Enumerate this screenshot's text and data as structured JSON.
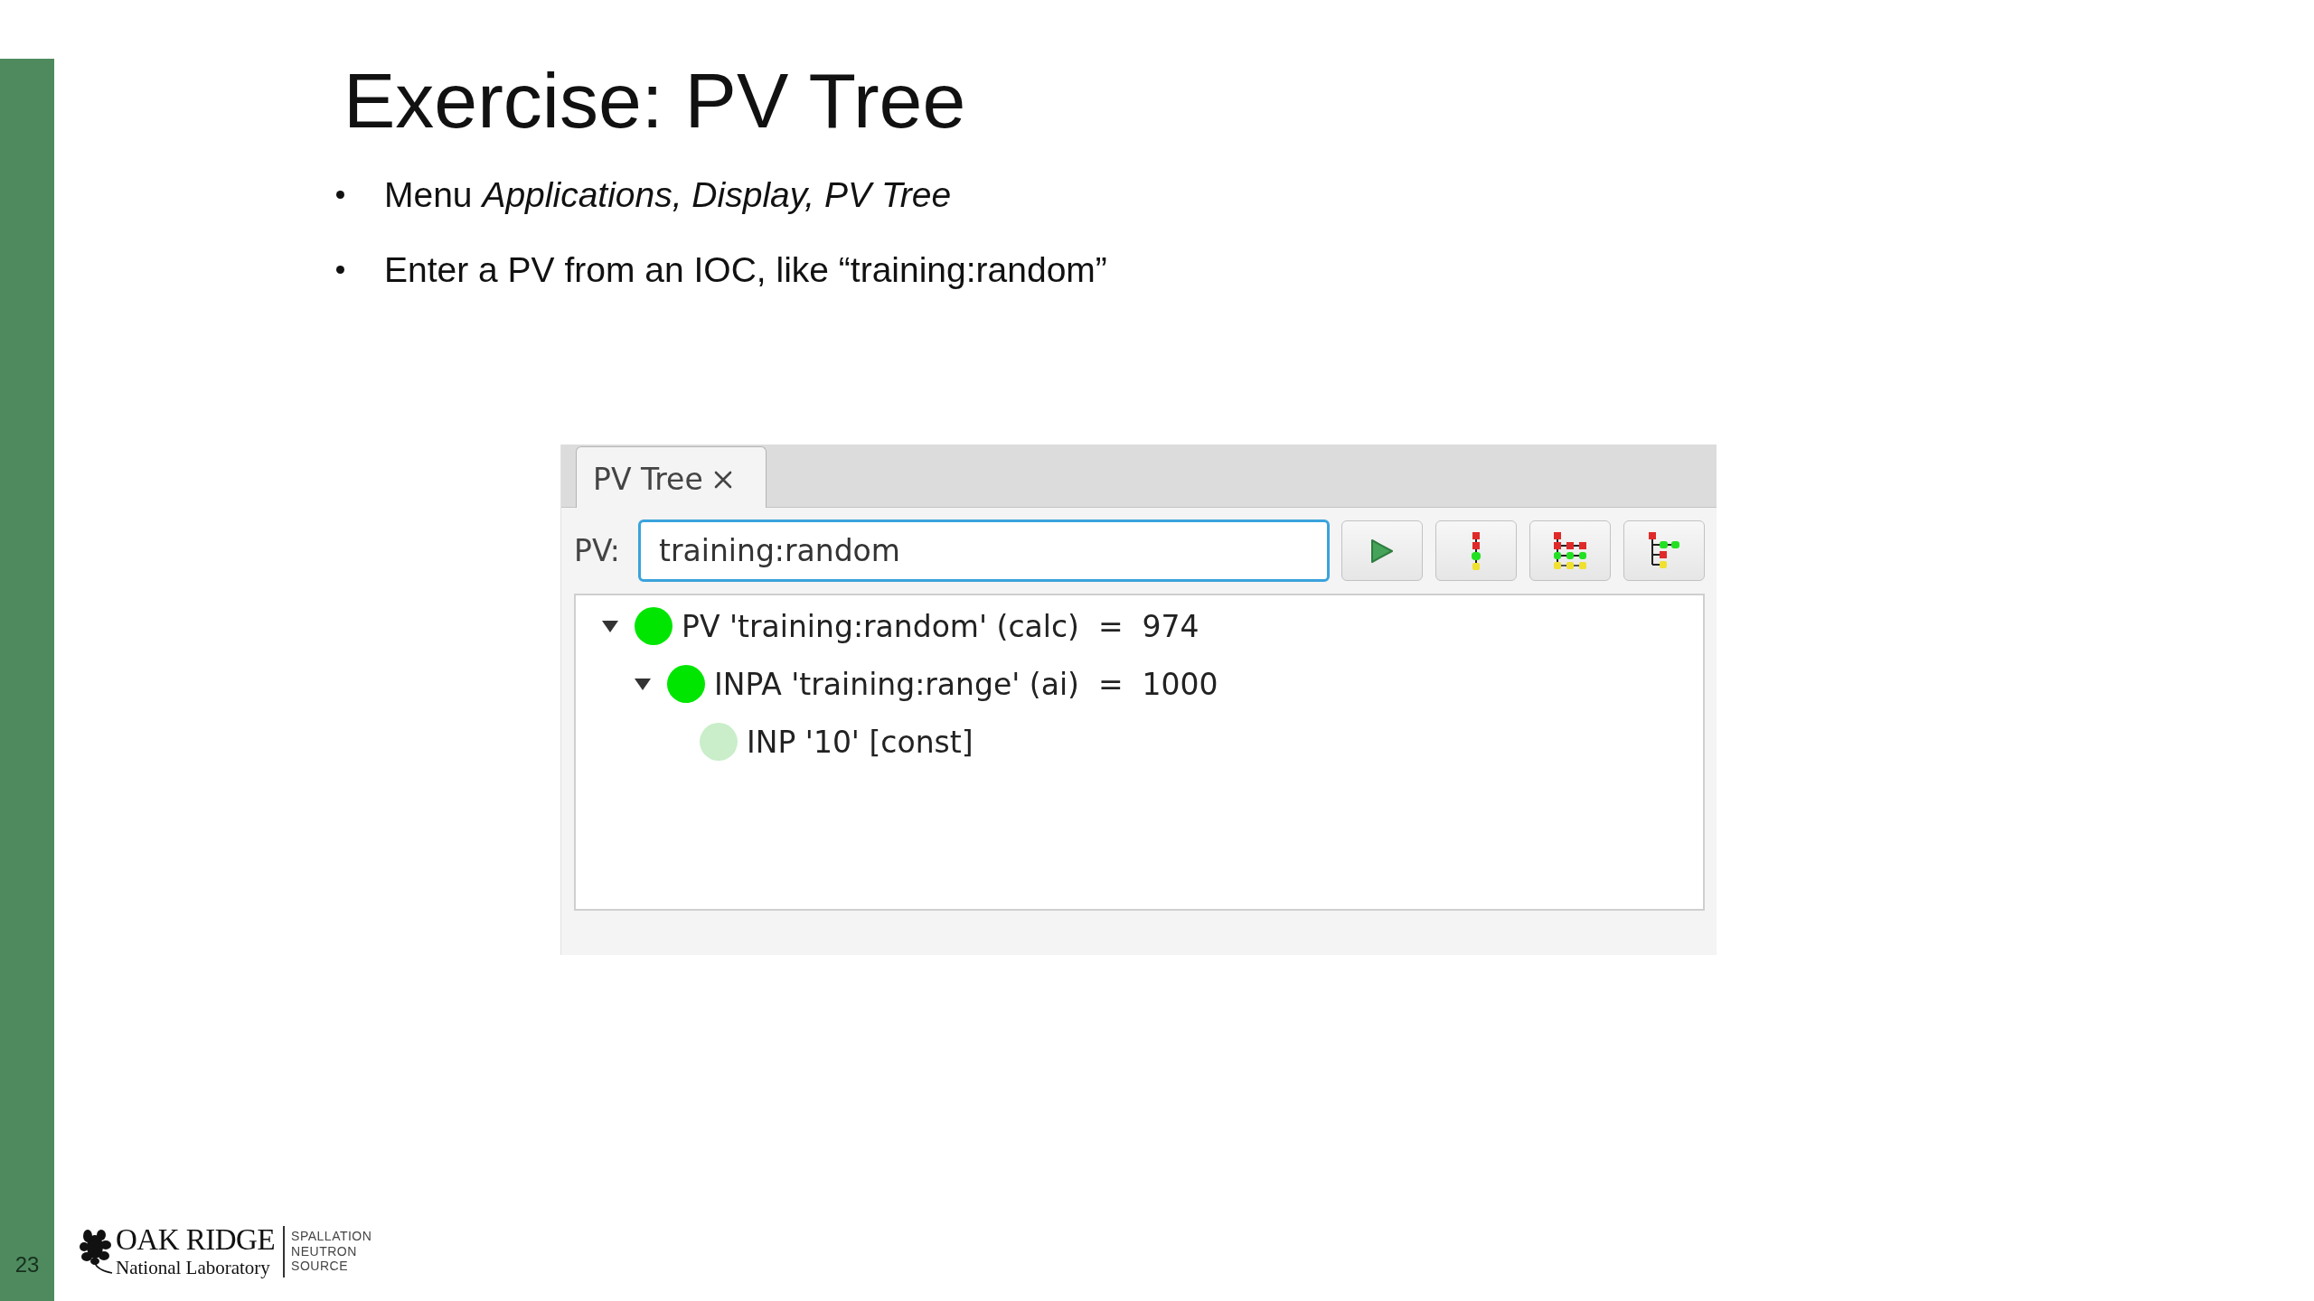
{
  "slide": {
    "title": "Exercise: PV Tree",
    "bullets": [
      "Menu *Applications, Display, PV Tree*",
      "Enter a PV from an IOC, like “training:random”"
    ]
  },
  "window": {
    "tabs": [
      {
        "label": "PV Tree",
        "selected": true
      }
    ],
    "pv_field": {
      "label": "PV:",
      "value": "training:random",
      "focused": true
    },
    "tree": [
      {
        "text": "PV 'training:random' (calc)  =  974",
        "color": "#00e600",
        "expanded": true,
        "children": [
          {
            "text": "INPA 'training:range' (ai)  =  1000",
            "color": "#00e600",
            "expanded": true,
            "children": [
              {
                "text": "INP '10' [const]",
                "color": "#c9eec9"
              }
            ]
          }
        ]
      }
    ]
  },
  "footer": {
    "page_number": "23",
    "logo": {
      "name": "OAK RIDGE",
      "subtitle": "National Laboratory",
      "facility_lines": [
        "SPALLATION",
        "NEUTRON",
        "SOURCE"
      ]
    }
  }
}
